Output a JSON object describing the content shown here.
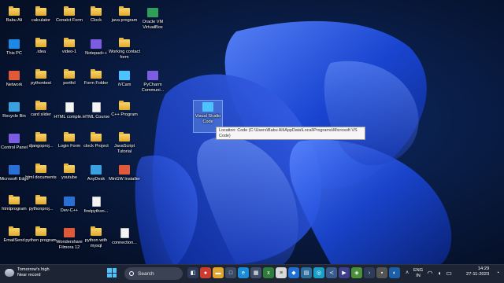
{
  "desktop_icons": [
    {
      "label": "Babu Ali",
      "type": "folder"
    },
    {
      "label": "calculator",
      "type": "folder"
    },
    {
      "label": "Conatct Form",
      "type": "folder"
    },
    {
      "label": "Clock",
      "type": "folder"
    },
    {
      "label": "java program",
      "type": "folder"
    },
    {
      "label": "Oracle VM VirtualBox",
      "type": "app"
    },
    {
      "label": "This PC",
      "type": "app"
    },
    {
      "label": ".idea",
      "type": "folder"
    },
    {
      "label": "video-1",
      "type": "folder"
    },
    {
      "label": "Notepad++",
      "type": "app"
    },
    {
      "label": "Working contact form",
      "type": "folder"
    },
    {
      "label": "Network",
      "type": "app"
    },
    {
      "label": "pythontest",
      "type": "folder"
    },
    {
      "label": "portfol",
      "type": "folder"
    },
    {
      "label": "Form Folder",
      "type": "folder"
    },
    {
      "label": "iVCam",
      "type": "app"
    },
    {
      "label": "PyCharm Communi...",
      "type": "app"
    },
    {
      "label": "Recycle Bin",
      "type": "app"
    },
    {
      "label": "card slider",
      "type": "folder"
    },
    {
      "label": "HTML comple...",
      "type": "file"
    },
    {
      "label": "HTML Course",
      "type": "file"
    },
    {
      "label": "C++ Program",
      "type": "folder"
    },
    {
      "label": "Visual Studio Code",
      "type": "app"
    },
    {
      "label": "Control Panel",
      "type": "app"
    },
    {
      "label": "djangoproj...",
      "type": "folder"
    },
    {
      "label": "Login Form",
      "type": "folder"
    },
    {
      "label": "clock Project",
      "type": "folder"
    },
    {
      "label": "JavaScript Tutorial",
      "type": "folder"
    },
    {
      "label": "Microsoft Edge",
      "type": "app"
    },
    {
      "label": "html documents",
      "type": "folder"
    },
    {
      "label": "youtube",
      "type": "folder"
    },
    {
      "label": "AnyDesk",
      "type": "app"
    },
    {
      "label": "MinGW Installer",
      "type": "app"
    },
    {
      "label": "htmlprogram",
      "type": "folder"
    },
    {
      "label": "pythonproj...",
      "type": "folder"
    },
    {
      "label": "Dev-C++",
      "type": "app"
    },
    {
      "label": "firstpython...",
      "type": "file"
    },
    {
      "label": "EmailSend",
      "type": "folder"
    },
    {
      "label": "python program",
      "type": "folder"
    },
    {
      "label": "Wondershare Filmora 12",
      "type": "app"
    },
    {
      "label": "python with mysql",
      "type": "folder"
    },
    {
      "label": "connection...",
      "type": "file"
    }
  ],
  "tooltip": {
    "text": "Location: Code (C:\\Users\\Babu Ali\\AppData\\Local\\Programs\\Microsoft VS Code)"
  },
  "taskbar": {
    "weather_title": "Tomorrow's high",
    "weather_sub": "Near record",
    "search_placeholder": "Search",
    "lang_top": "ENG",
    "lang_bottom": "IN",
    "time": "14:29",
    "date": "27-11-2023"
  },
  "colors": {
    "accent": "#4cc2ff",
    "taskbar": "#1d2433",
    "wallpaper_dark": "#06122c",
    "wallpaper_bloom": "#1f4fe0"
  }
}
